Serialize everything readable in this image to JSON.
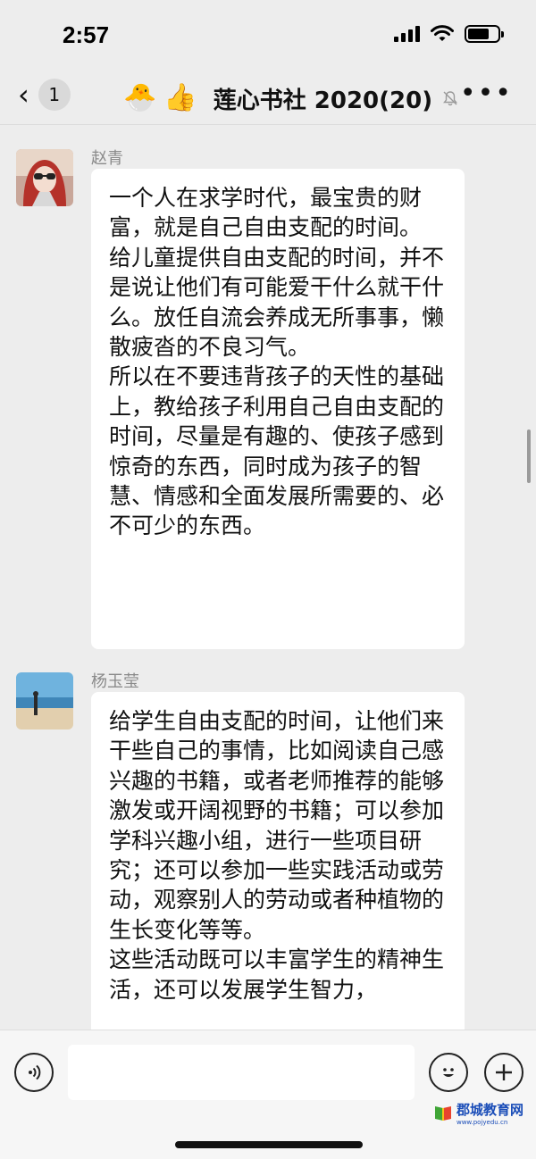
{
  "status_bar": {
    "time": "2:57"
  },
  "nav": {
    "back_badge": "1",
    "emojis": [
      "🐣",
      "👍"
    ],
    "title": "莲心书社 2020(20)",
    "more_label": "•••"
  },
  "messages": [
    {
      "sender": "赵青",
      "text": "一个人在求学时代，最宝贵的财富，就是自己自由支配的时间。\n给儿童提供自由支配的时间，并不是说让他们有可能爱干什么就干什么。放任自流会养成无所事事，懒散疲沓的不良习气。\n所以在不要违背孩子的天性的基础上，教给孩子利用自己自由支配的时间，尽量是有趣的、使孩子感到惊奇的东西，同时成为孩子的智慧、情感和全面发展所需要的、必不可少的东西。"
    },
    {
      "sender": "杨玉莹",
      "text": "给学生自由支配的时间，让他们来干些自己的事情，比如阅读自己感兴趣的书籍，或者老师推荐的能够激发或开阔视野的书籍；可以参加学科兴趣小组，进行一些项目研究；还可以参加一些实践活动或劳动，观察别人的劳动或者种植物的生长变化等等。\n这些活动既可以丰富学生的精神生活，还可以发展学生智力，"
    }
  ],
  "input_bar": {
    "placeholder": ""
  },
  "watermark": {
    "text": "郡城教育网",
    "subtext": "www.pojyedu.cn"
  },
  "colors": {
    "background": "#ededed",
    "bubble": "#ffffff",
    "name": "#8a8a8a",
    "watermark": "#1a4db8"
  }
}
